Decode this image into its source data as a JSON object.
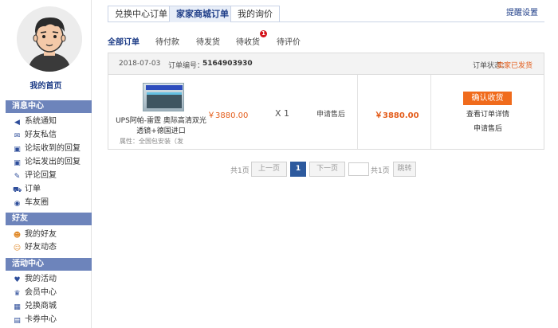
{
  "sidebar": {
    "home_label": "我的首页",
    "sections": [
      {
        "title": "消息中心",
        "items": [
          {
            "label": "系统通知",
            "icon": "speaker-icon"
          },
          {
            "label": "好友私信",
            "icon": "envelope-icon"
          },
          {
            "label": "论坛收到的回复",
            "icon": "reply-in-icon"
          },
          {
            "label": "论坛发出的回复",
            "icon": "reply-out-icon"
          },
          {
            "label": "评论回复",
            "icon": "edit-icon"
          },
          {
            "label": "订单",
            "icon": "cart-icon"
          },
          {
            "label": "车友圈",
            "icon": "circle-icon"
          }
        ]
      },
      {
        "title": "好友",
        "items": [
          {
            "label": "我的好友",
            "icon": "friends-icon"
          },
          {
            "label": "好友动态",
            "icon": "friend-feed-icon"
          }
        ]
      },
      {
        "title": "活动中心",
        "items": [
          {
            "label": "我的活动",
            "icon": "heart-icon"
          },
          {
            "label": "会员中心",
            "icon": "member-icon"
          },
          {
            "label": "兑换商城",
            "icon": "gift-icon"
          },
          {
            "label": "卡券中心",
            "icon": "ticket-icon"
          }
        ]
      }
    ]
  },
  "tabs": {
    "items": [
      "兑换中心订单",
      "家家商城订单",
      "我的询价"
    ],
    "active_index": 1,
    "remind_label": "提醒设置"
  },
  "subtabs": {
    "items": [
      "全部订单",
      "待付款",
      "待发货",
      "待收货",
      "待评价"
    ],
    "active_index": 0,
    "badge": "1"
  },
  "order": {
    "date": "2018-07-03",
    "number_label": "订单编号：",
    "number": "5164903930",
    "status_label": "订单状态：",
    "status": "卖家已发货",
    "product_name": "UPS阿帕-雷霆 奥际高清双光透镜+德国进口",
    "product_attr": "属性：全国包安装（发",
    "price": "￥3880.00",
    "quantity": "X 1",
    "aftersale": "申请售后",
    "total": "￥3880.00",
    "confirm_label": "确认收货",
    "detail_label": "查看订单详情",
    "aftersale_link": "申请售后"
  },
  "pagination": {
    "total_pages_text": "共1页",
    "prev_label": "上一页",
    "current_page": "1",
    "next_label": "下一页",
    "page_suffix": "共1页",
    "jump_label": "跳转"
  },
  "colors": {
    "accent": "#1d3c87",
    "section_bg": "#6d84bb",
    "price": "#e35c1a",
    "confirm_btn": "#f06b1c",
    "badge": "#d4141b"
  }
}
